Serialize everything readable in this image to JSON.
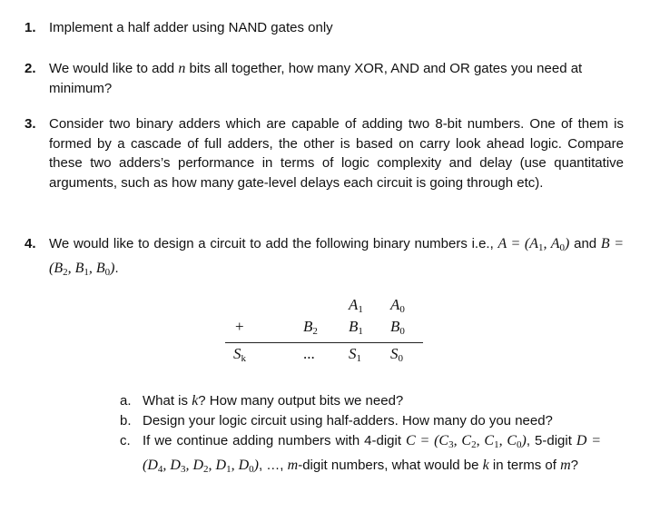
{
  "questions": [
    {
      "number": "1.",
      "text": "Implement a half adder using NAND gates only"
    },
    {
      "number": "2.",
      "text_before": "We would like to add ",
      "var": "n",
      "text_after": " bits all together, how many XOR, AND and OR gates you need at minimum?"
    },
    {
      "number": "3.",
      "text": "Consider two binary adders which are capable of adding two 8-bit numbers. One of them is formed by a cascade of full adders, the other is based on carry look ahead logic. Compare these two adders’s performance in terms of logic complexity and delay (use quantitative arguments, such as how many gate-level delays each circuit is going through etc)."
    },
    {
      "number": "4.",
      "text_before": "We would like to design a circuit to add the following binary numbers i.e., ",
      "mid": " and ",
      "end": "."
    }
  ],
  "addition_table": {
    "row1": [
      "A",
      "1",
      "A",
      "0"
    ],
    "plus": "+",
    "row2": [
      "B",
      "2",
      "B",
      "1",
      "B",
      "0"
    ],
    "row3": [
      "S",
      "k",
      "...",
      "S",
      "1",
      "S",
      "0"
    ]
  },
  "subquestions": [
    {
      "label": "a.",
      "text_before": "What is ",
      "var": "k",
      "text_after": "? How many output bits we need?"
    },
    {
      "label": "b.",
      "text": "Design your logic circuit using half-adders. How many do you need?"
    },
    {
      "label": "c.",
      "text_before": "If we continue adding numbers with 4-digit ",
      "mid1": ", 5-digit ",
      "mid2": ", …, ",
      "var_m": "m",
      "mid3": "-digit numbers, what would be ",
      "var_k": "k",
      "mid4": " in terms of ",
      "var_m2": "m",
      "end": "?"
    }
  ]
}
